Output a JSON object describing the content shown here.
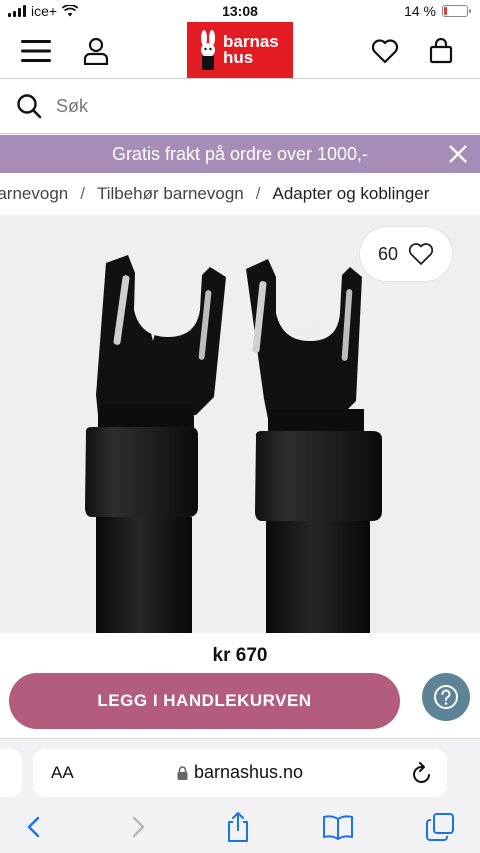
{
  "status_bar": {
    "carrier": "ice+",
    "time": "13:08",
    "battery": "14 %",
    "battery_level": 0.14
  },
  "header": {
    "logo": {
      "line1": "barnas",
      "line2": "hus"
    },
    "icons": [
      "menu-icon",
      "user-icon",
      "heart-icon",
      "cart-icon"
    ]
  },
  "search": {
    "placeholder": "Søk"
  },
  "promo": {
    "text": "Gratis frakt på ordre over 1000,-"
  },
  "breadcrumb": {
    "items": [
      "Barnevogn",
      "Tilbehør barnevogn",
      "Adapter og koblinger"
    ]
  },
  "product": {
    "favorites_count": "60",
    "price": "kr 670",
    "add_to_cart": "LEGG I HANDLEKURVEN"
  },
  "browser": {
    "aa": "AA",
    "url": "barnashus.no"
  },
  "colors": {
    "brand_red": "#e31c23",
    "promo_purple": "#a68db7",
    "cta_pink": "#b45c7e",
    "help_blue": "#5e8296",
    "browser_blue": "#1a73e8"
  }
}
